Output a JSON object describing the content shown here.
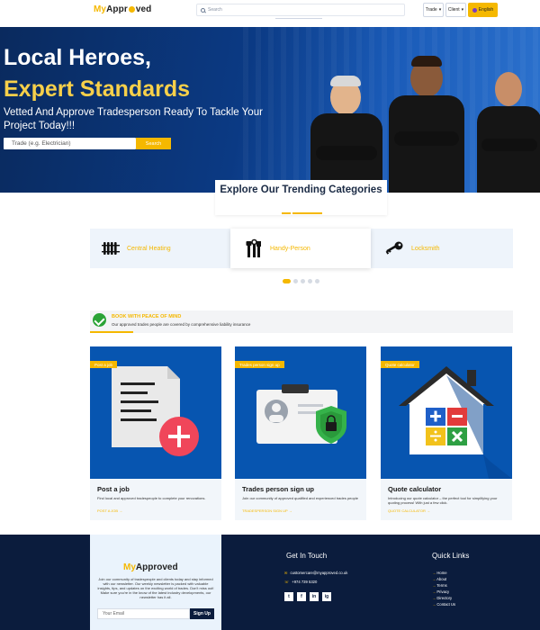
{
  "header": {
    "logo_my": "My",
    "logo_rest_1": "Appr",
    "logo_rest_2": "ved",
    "search_placeholder": "Search",
    "trade_label": "Trade",
    "client_label": "Client",
    "language_label": "English"
  },
  "hero": {
    "title_line1": "Local Heroes,",
    "title_line2": "Expert Standards",
    "subtitle": "Vetted And Approve Tradesperson Ready To Tackle Your Project Today!!!",
    "input_placeholder": "Trade (e.g. Electrician)",
    "search_button": "Search"
  },
  "trending": {
    "title": "Explore Our Trending Categories",
    "categories": [
      {
        "label": "Central Heating",
        "icon": "radiator-icon"
      },
      {
        "label": "Handy-Person",
        "icon": "tools-icon"
      },
      {
        "label": "Locksmith",
        "icon": "key-icon"
      }
    ],
    "active_index": 1
  },
  "book": {
    "title": "BOOK WITH PEACE OF MIND",
    "subtitle": "Our approved trades people are covered by comprehensive liability insurance"
  },
  "cards": [
    {
      "tag": "Post a job",
      "title": "Post a job",
      "desc": "Find local and approved tradespeople to complete your renovations.",
      "link": "POST A JOB →"
    },
    {
      "tag": "Trades person sign up",
      "title": "Trades person sign up",
      "desc": "Join our community of approved qualified and experienced trades people",
      "link": "TRADESPERSON SIGN UP →"
    },
    {
      "tag": "Quote calculator",
      "title": "Quote calculator",
      "desc": "Introducing our quote calculator – the perfect tool for simplifying your quoting process! With just a few click.",
      "link": "QUOTE CALCULATOR →"
    }
  ],
  "footer": {
    "logo_my": "My",
    "logo_rest": "Approved",
    "description": "Join our community of tradespeople and clients today and stay informed with our newsletter. Our weekly newsletter is packed with valuable insights, tips, and updates on the exciting world of trades. Don't miss out! Make sure you're in the know of the latest industry developments, our newsletter has it all.",
    "email_placeholder": "Your Email",
    "signup_button": "Sign Up",
    "get_in_touch_title": "Get In Touch",
    "email": "customercare@myapproved.co.uk",
    "phone": "+974 739 5320",
    "social": [
      "t",
      "f",
      "in",
      "ig"
    ],
    "quick_links_title": "Quick Links",
    "quick_links": [
      "Home",
      "About",
      "Terms",
      "Privacy",
      "Directory",
      "Contact Us"
    ]
  },
  "colors": {
    "accent": "#f5b800",
    "hero_blue": "#0b3a84",
    "footer_navy": "#0b1c3d",
    "card_blue": "#0755b0"
  }
}
